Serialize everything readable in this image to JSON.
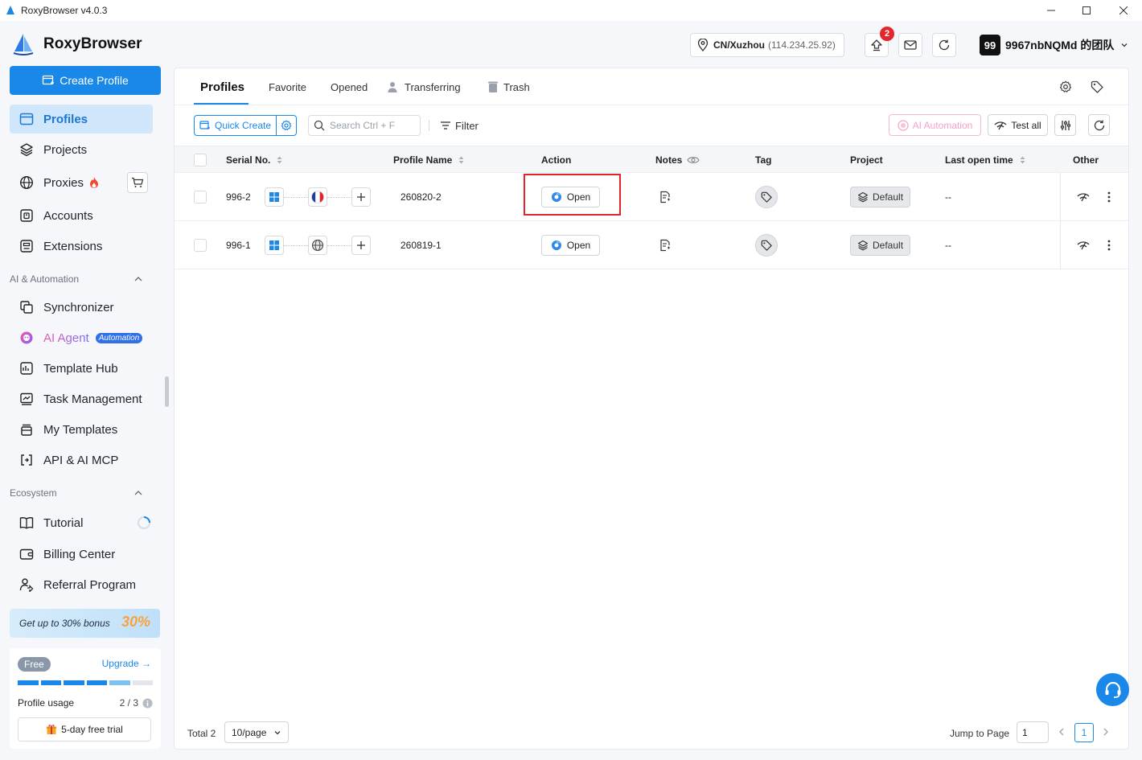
{
  "window": {
    "title": "RoxyBrowser v4.0.3"
  },
  "header": {
    "brand": "RoxyBrowser",
    "location_city": "CN/Xuzhou",
    "location_ip": "(114.234.25.92)",
    "notification_count": "2",
    "team_avatar": "99",
    "team_name": "9967nbNQMd 的团队"
  },
  "sidebar": {
    "create_label": "Create Profile",
    "items": [
      {
        "label": "Profiles",
        "icon": "profiles-icon"
      },
      {
        "label": "Projects",
        "icon": "layers-icon"
      },
      {
        "label": "Proxies",
        "icon": "globe-icon"
      },
      {
        "label": "Accounts",
        "icon": "account-icon"
      },
      {
        "label": "Extensions",
        "icon": "extension-icon"
      }
    ],
    "section_ai": "AI & Automation",
    "ai_items": [
      {
        "label": "Synchronizer"
      },
      {
        "label": "AI Agent",
        "tag": "Automation"
      },
      {
        "label": "Template Hub"
      },
      {
        "label": "Task Management"
      },
      {
        "label": "My Templates"
      },
      {
        "label": "API & AI MCP"
      }
    ],
    "section_eco": "Ecosystem",
    "eco_items": [
      {
        "label": "Tutorial"
      },
      {
        "label": "Billing Center"
      },
      {
        "label": "Referral Program"
      }
    ],
    "promo_text": "Get up to 30% bonus",
    "promo_pct": "30%",
    "plan_badge": "Free",
    "upgrade_label": "Upgrade →",
    "usage_label": "Profile usage",
    "usage_value": "2 / 3",
    "usage_fraction": 0.667,
    "trial_label": "5-day free trial"
  },
  "tabs": {
    "profiles": "Profiles",
    "favorite": "Favorite",
    "opened": "Opened",
    "transferring": "Transferring",
    "trash": "Trash"
  },
  "toolbar": {
    "quick_create": "Quick Create",
    "search_placeholder": "Search Ctrl + F",
    "filter": "Filter",
    "ai_automation": "AI Automation",
    "test_all": "Test all"
  },
  "table": {
    "headers": {
      "serial": "Serial No.",
      "name": "Profile Name",
      "action": "Action",
      "notes": "Notes",
      "tag": "Tag",
      "project": "Project",
      "last_open": "Last open time",
      "other": "Other"
    },
    "rows": [
      {
        "serial": "996-2",
        "name": "260820-2",
        "action": "Open",
        "project": "Default",
        "last_open": "--",
        "proxy_icon": "france-flag-icon"
      },
      {
        "serial": "996-1",
        "name": "260819-1",
        "action": "Open",
        "project": "Default",
        "last_open": "--",
        "proxy_icon": "globe-icon"
      }
    ]
  },
  "footer": {
    "total": "Total 2",
    "page_size": "10/page",
    "jump_label": "Jump to Page",
    "jump_value": "1",
    "current_page": "1"
  },
  "colors": {
    "accent": "#1a88e8",
    "highlight": "#e0252b",
    "ai": "#f4a0c8"
  }
}
